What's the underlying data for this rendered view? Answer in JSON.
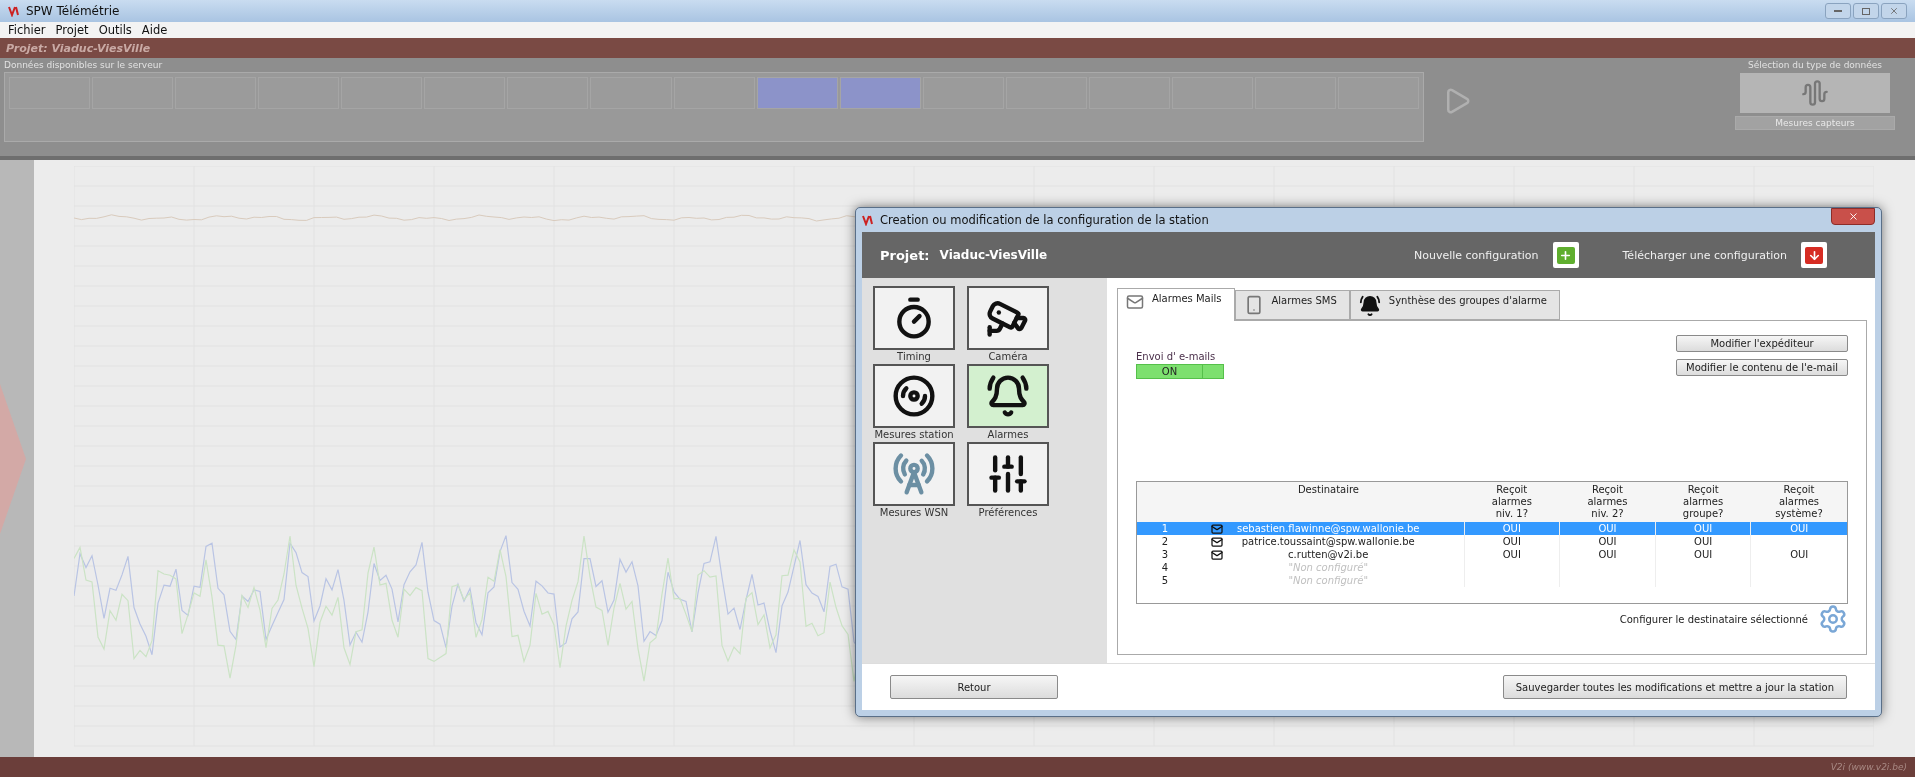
{
  "window": {
    "title": "SPW Télémétrie"
  },
  "menu": [
    "Fichier",
    "Projet",
    "Outils",
    "Aide"
  ],
  "project_bar": {
    "title": "Projet: Viaduc-ViesVille"
  },
  "month_strip": {
    "title": "Données disponibles sur le serveur",
    "tiles": [
      {
        "selected": false
      },
      {
        "selected": false
      },
      {
        "selected": false
      },
      {
        "selected": false
      },
      {
        "selected": false
      },
      {
        "selected": false
      },
      {
        "selected": false
      },
      {
        "selected": false
      },
      {
        "selected": false
      },
      {
        "selected": true
      },
      {
        "selected": true
      },
      {
        "selected": false
      },
      {
        "selected": false
      },
      {
        "selected": false
      },
      {
        "selected": false
      },
      {
        "selected": false
      },
      {
        "selected": false
      }
    ]
  },
  "data_type_selector": {
    "title": "Sélection du type de données",
    "button": "Mesures capteurs"
  },
  "dialog": {
    "title": "Creation ou modification de la configuration de la station",
    "project_label": "Projet:",
    "project_name": "Viaduc-ViesVille",
    "actions": [
      {
        "label": "Nouvelle configuration",
        "kind": "new"
      },
      {
        "label": "Télécharger une configuration",
        "kind": "download"
      }
    ],
    "categories": [
      {
        "label": "Timing",
        "kind": "timer",
        "selected": false
      },
      {
        "label": "Caméra",
        "kind": "camera",
        "selected": false
      },
      {
        "label": "Mesures station",
        "kind": "tape",
        "selected": false
      },
      {
        "label": "Alarmes",
        "kind": "bell",
        "selected": true
      },
      {
        "label": "Mesures WSN",
        "kind": "sensor",
        "selected": false
      },
      {
        "label": "Préférences",
        "kind": "sliders",
        "selected": false
      }
    ],
    "tabs": [
      {
        "label": "Alarmes Mails",
        "kind": "mail",
        "selected": true
      },
      {
        "label": "Alarmes SMS",
        "kind": "phone",
        "selected": false
      },
      {
        "label": "Synthèse des groupes d'alarme",
        "kind": "bells",
        "selected": false
      }
    ],
    "email_toggle": {
      "label": "Envoi d' e-mails",
      "value": "ON",
      "on": true
    },
    "side_buttons": [
      "Modifier l'expéditeur",
      "Modifier le contenu de l'e-mail"
    ],
    "table": {
      "columns": [
        "",
        "Destinataire",
        "Reçoit alarmes niv. 1?",
        "Reçoit alarmes niv. 2?",
        "Reçoit alarmes groupe?",
        "Reçoit alarmes système?"
      ],
      "rows": [
        {
          "configured": true,
          "cells": [
            "1",
            "sebastien.flawinne@spw.wallonie.be",
            "OUI",
            "OUI",
            "OUI",
            "OUI"
          ],
          "selected": true
        },
        {
          "configured": true,
          "cells": [
            "2",
            "patrice.toussaint@spw.wallonie.be",
            "OUI",
            "OUI",
            "OUI",
            ""
          ],
          "selected": false
        },
        {
          "configured": true,
          "cells": [
            "3",
            "c.rutten@v2i.be",
            "OUI",
            "OUI",
            "OUI",
            "OUI"
          ],
          "selected": false
        },
        {
          "configured": false,
          "cells": [
            "4",
            "\"Non configuré\"",
            "",
            "",
            "",
            ""
          ],
          "selected": false
        },
        {
          "configured": false,
          "cells": [
            "5",
            "\"Non configuré\"",
            "",
            "",
            "",
            ""
          ],
          "selected": false
        }
      ]
    },
    "configure_label": "Configurer le destinataire sélectionné",
    "back_button": "Retour",
    "save_button": "Sauvegarder toutes les modifications et mettre a jour la station"
  },
  "status_bar": {
    "credit": "V2i (www.v2i.be)"
  }
}
